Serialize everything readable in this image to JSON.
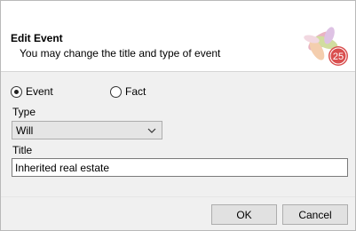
{
  "header": {
    "title": "Edit Event",
    "subtitle": "You may change the title and type of event",
    "logo_text": "25"
  },
  "form": {
    "kind_options": [
      {
        "label": "Event",
        "checked": true
      },
      {
        "label": "Fact",
        "checked": false
      }
    ],
    "type_label": "Type",
    "type_value": "Will",
    "title_label": "Title",
    "title_value": "Inherited real estate"
  },
  "buttons": {
    "ok": "OK",
    "cancel": "Cancel"
  },
  "colors": {
    "logo_badge": "#d94f4f",
    "logo_petals": [
      "#e6a6b8",
      "#c9d88f",
      "#f3c6a0",
      "#d9b8e0"
    ]
  }
}
